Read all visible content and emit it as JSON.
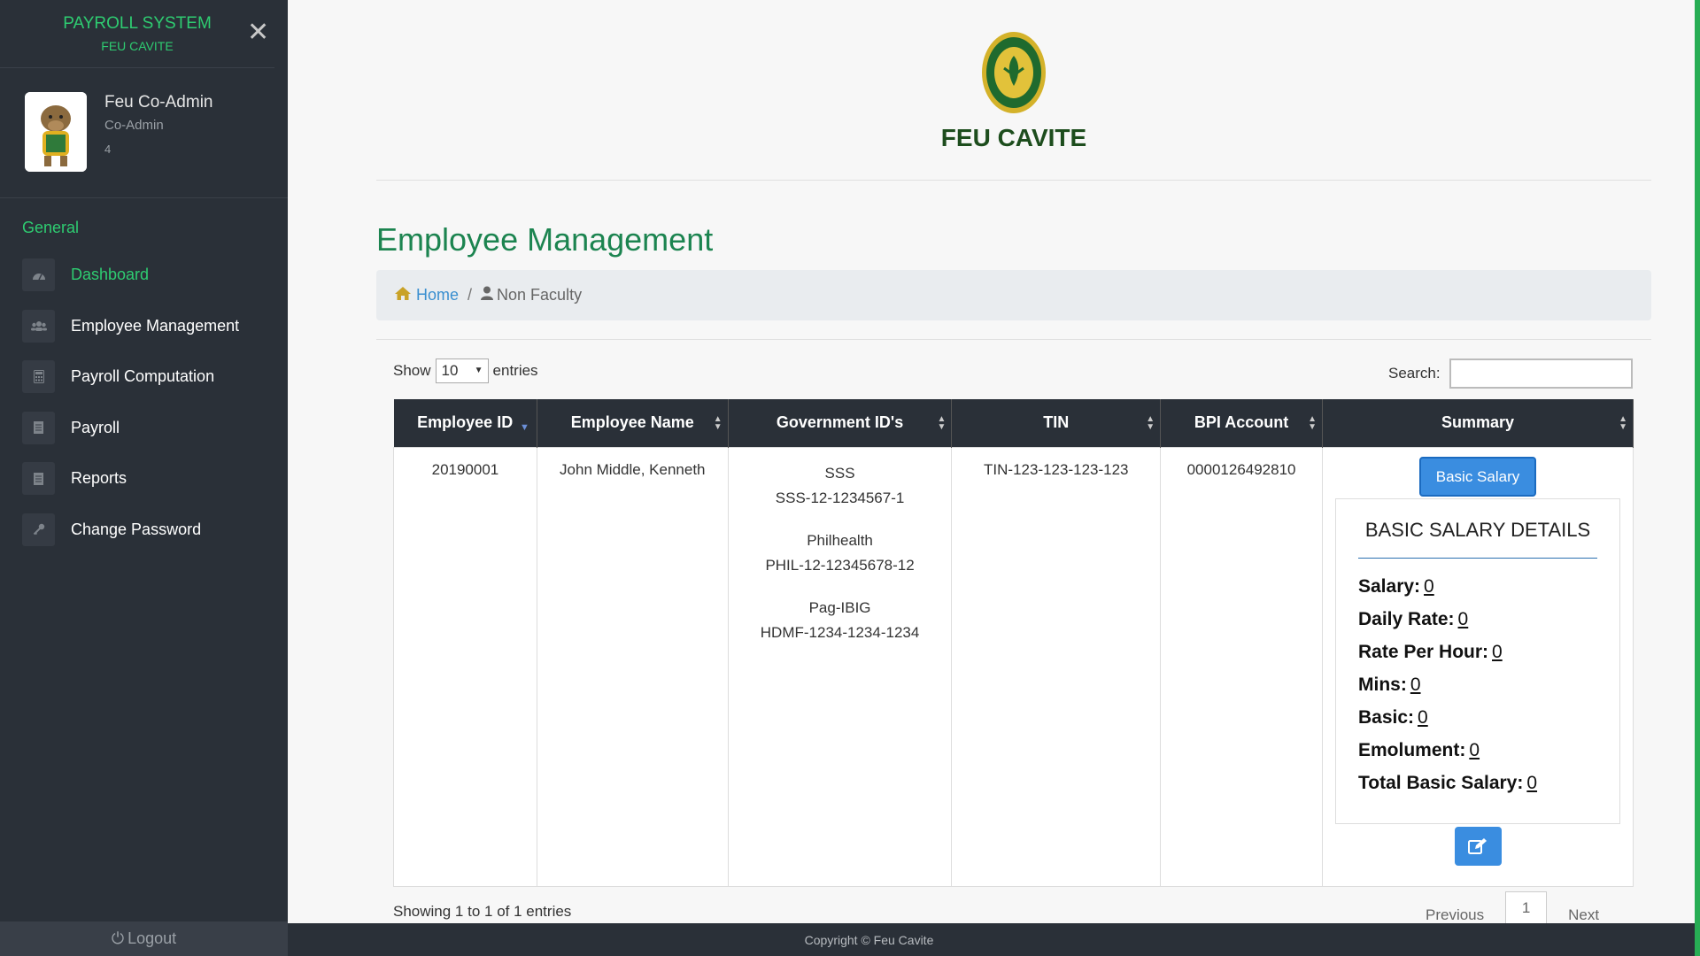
{
  "sidebar": {
    "brand_title": "PAYROLL SYSTEM",
    "brand_subtitle": "FEU CAVITE",
    "close_icon": "close-icon",
    "profile": {
      "name": "Feu Co-Admin",
      "role": "Co-Admin",
      "id": "4"
    },
    "menu_header": "General",
    "items": [
      {
        "label": "Dashboard",
        "icon": "dashboard-icon",
        "active": true
      },
      {
        "label": "Employee Management",
        "icon": "users-icon",
        "active": false
      },
      {
        "label": "Payroll Computation",
        "icon": "calculator-icon",
        "active": false
      },
      {
        "label": "Payroll",
        "icon": "document-icon",
        "active": false
      },
      {
        "label": "Reports",
        "icon": "document-icon",
        "active": false
      },
      {
        "label": "Change Password",
        "icon": "key-icon",
        "active": false
      }
    ],
    "logout_label": "Logout"
  },
  "header": {
    "logo_text": "FEU CAVITE"
  },
  "page_title": "Employee Management",
  "breadcrumb": {
    "home": "Home",
    "current": "Non Faculty"
  },
  "table_controls": {
    "show_label": "Show",
    "entries_value": "10",
    "entries_label": "entries",
    "search_label": "Search:",
    "search_value": ""
  },
  "table": {
    "headers": [
      "Employee ID",
      "Employee Name",
      "Government ID's",
      "TIN",
      "BPI Account",
      "Summary"
    ],
    "row": {
      "employee_id": "20190001",
      "employee_name": "John Middle, Kenneth",
      "gov_ids": [
        {
          "type": "SSS",
          "value": "SSS-12-1234567-1"
        },
        {
          "type": "Philhealth",
          "value": "PHIL-12-12345678-12"
        },
        {
          "type": "Pag-IBIG",
          "value": "HDMF-1234-1234-1234"
        }
      ],
      "tin": "TIN-123-123-123-123",
      "bpi_account": "0000126492810",
      "summary_button": "Basic Salary",
      "card_title": "BASIC SALARY DETAILS",
      "salary": [
        {
          "label": "Salary:",
          "value": "0"
        },
        {
          "label": "Daily Rate:",
          "value": "0"
        },
        {
          "label": "Rate Per Hour:",
          "value": "0"
        },
        {
          "label": "Mins:",
          "value": "0"
        },
        {
          "label": "Basic:",
          "value": "0"
        },
        {
          "label": "Emolument:",
          "value": "0"
        },
        {
          "label": "Total Basic Salary:",
          "value": "0"
        }
      ]
    }
  },
  "footer_info": {
    "showing": "Showing 1 to 1 of 1 entries",
    "previous": "Previous",
    "page": "1",
    "next": "Next"
  },
  "copyright": "Copyright © Feu Cavite",
  "colors": {
    "accent_green": "#2ecc71",
    "title_green": "#1c8450",
    "sidebar_bg": "#2a3038",
    "button_blue": "#3a8de0"
  }
}
